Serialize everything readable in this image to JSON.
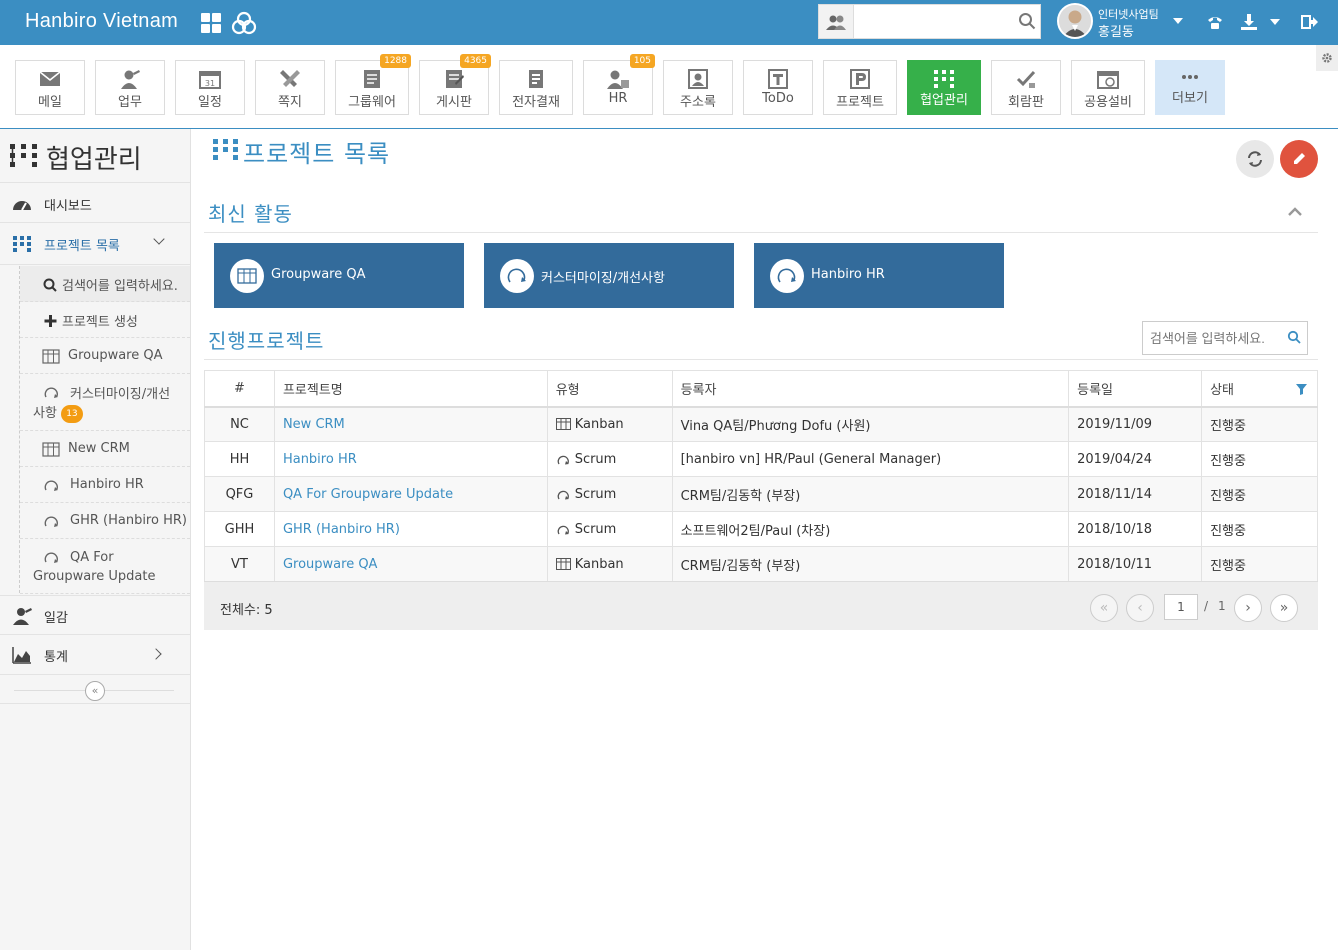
{
  "topbar": {
    "brand": "Hanbiro Vietnam",
    "search_placeholder": "",
    "user_team": "인터넷사업팀",
    "user_name": "홍길동"
  },
  "toolbar": {
    "items": [
      {
        "label": "메일",
        "icon": "mail-icon",
        "badge": ""
      },
      {
        "label": "업무",
        "icon": "task-icon",
        "badge": ""
      },
      {
        "label": "일정",
        "icon": "calendar-icon",
        "badge": ""
      },
      {
        "label": "쪽지",
        "icon": "memo-icon",
        "badge": ""
      },
      {
        "label": "그룹웨어",
        "icon": "groupware-icon",
        "badge": "1288"
      },
      {
        "label": "게시판",
        "icon": "board-icon",
        "badge": "4365"
      },
      {
        "label": "전자결재",
        "icon": "approval-icon",
        "badge": ""
      },
      {
        "label": "HR",
        "icon": "hr-icon",
        "badge": "105"
      },
      {
        "label": "주소록",
        "icon": "contacts-icon",
        "badge": ""
      },
      {
        "label": "ToDo",
        "icon": "todo-icon",
        "badge": ""
      },
      {
        "label": "프로젝트",
        "icon": "project-icon",
        "badge": ""
      },
      {
        "label": "협업관리",
        "icon": "collab-icon",
        "badge": ""
      },
      {
        "label": "회람판",
        "icon": "circular-icon",
        "badge": ""
      },
      {
        "label": "공용설비",
        "icon": "facility-icon",
        "badge": ""
      },
      {
        "label": "더보기",
        "icon": "more-icon",
        "badge": ""
      }
    ]
  },
  "sidebar": {
    "title": "협업관리",
    "dashboard": "대시보드",
    "project_list": "프로젝트 목록",
    "search_placeholder": "검색어를 입력하세요.",
    "create_project": "프로젝트 생성",
    "projects": [
      {
        "name": "Groupware QA",
        "type": "kanban"
      },
      {
        "name": "커스터마이징/개선사항",
        "type": "scrum",
        "badge": "13"
      },
      {
        "name": "New CRM",
        "type": "kanban"
      },
      {
        "name": "Hanbiro HR",
        "type": "scrum"
      },
      {
        "name": "GHR (Hanbiro HR)",
        "type": "scrum"
      },
      {
        "name": "QA For Groupware Update",
        "type": "scrum"
      }
    ],
    "diary": "일감",
    "stats": "통계"
  },
  "main": {
    "title": "프로젝트 목록",
    "recent_title": "최신 활동",
    "recent_cards": [
      "Groupware QA",
      "커스터마이징/개선사항",
      "Hanbiro HR"
    ],
    "ongoing_title": "진행프로젝트",
    "search_placeholder": "검색어를 입력하세요.",
    "table": {
      "headers": [
        "#",
        "프로젝트명",
        "유형",
        "등록자",
        "등록일",
        "상태"
      ],
      "rows": [
        {
          "code": "NC",
          "name": "New CRM",
          "type": "Kanban",
          "owner": "Vina QA팀/Phương Dofu (사원)",
          "date": "2019/11/09",
          "status": "진행중"
        },
        {
          "code": "HH",
          "name": "Hanbiro HR",
          "type": "Scrum",
          "owner": "[hanbiro vn] HR/Paul (General Manager)",
          "date": "2019/04/24",
          "status": "진행중"
        },
        {
          "code": "QFG",
          "name": "QA For Groupware Update",
          "type": "Scrum",
          "owner": "CRM팀/김동학 (부장)",
          "date": "2018/11/14",
          "status": "진행중"
        },
        {
          "code": "GHH",
          "name": "GHR (Hanbiro HR)",
          "type": "Scrum",
          "owner": "소프트웨어2팀/Paul (차장)",
          "date": "2018/10/18",
          "status": "진행중"
        },
        {
          "code": "VT",
          "name": "Groupware QA",
          "type": "Kanban",
          "owner": "CRM팀/김동학 (부장)",
          "date": "2018/10/11",
          "status": "진행중"
        }
      ]
    },
    "total_label": "전체수: 5",
    "pager": {
      "current": "1",
      "sep": "/",
      "total": "1"
    }
  },
  "colors": {
    "topbar": "#3b8ec2",
    "active_app": "#36b04a",
    "card": "#336b9b",
    "accent": "#3b8ec2",
    "edit_button": "#e0533e"
  }
}
